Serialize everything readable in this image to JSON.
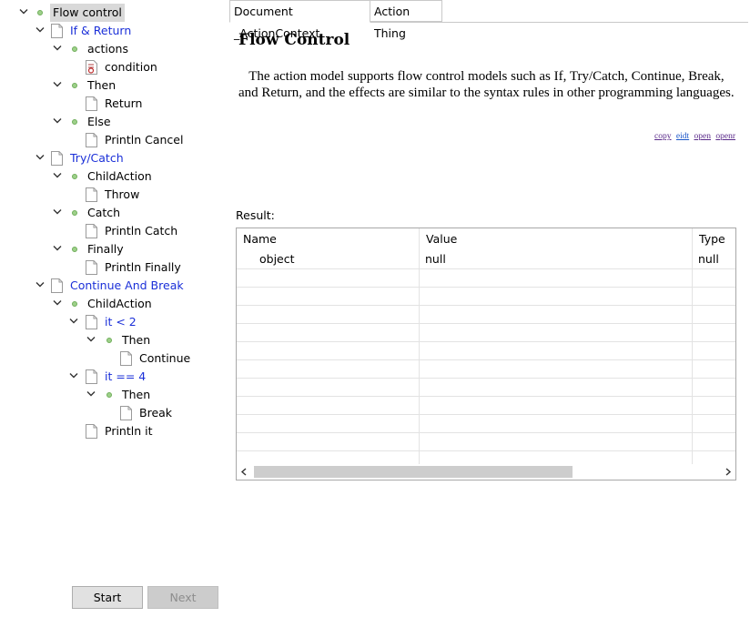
{
  "tree": {
    "nodes": [
      {
        "label": "Flow control",
        "kind": "dot",
        "expanded": true,
        "link": false,
        "selected": true
      },
      {
        "label": "If & Return",
        "kind": "doc",
        "expanded": true,
        "link": true
      },
      {
        "label": "actions",
        "kind": "dot",
        "expanded": true,
        "link": false
      },
      {
        "label": "condition",
        "kind": "doc-special",
        "expanded": null,
        "link": false
      },
      {
        "label": "Then",
        "kind": "dot",
        "expanded": true,
        "link": false
      },
      {
        "label": "Return",
        "kind": "doc",
        "expanded": null,
        "link": false
      },
      {
        "label": "Else",
        "kind": "dot",
        "expanded": true,
        "link": false
      },
      {
        "label": "Println Cancel",
        "kind": "doc",
        "expanded": null,
        "link": false
      },
      {
        "label": "Try/Catch",
        "kind": "doc",
        "expanded": true,
        "link": true
      },
      {
        "label": "ChildAction",
        "kind": "dot",
        "expanded": true,
        "link": false
      },
      {
        "label": "Throw",
        "kind": "doc",
        "expanded": null,
        "link": false
      },
      {
        "label": "Catch",
        "kind": "dot",
        "expanded": true,
        "link": false
      },
      {
        "label": "Println Catch",
        "kind": "doc",
        "expanded": null,
        "link": false
      },
      {
        "label": "Finally",
        "kind": "dot",
        "expanded": true,
        "link": false
      },
      {
        "label": "Println Finally",
        "kind": "doc",
        "expanded": null,
        "link": false
      },
      {
        "label": "Continue And Break",
        "kind": "doc",
        "expanded": true,
        "link": true
      },
      {
        "label": "ChildAction",
        "kind": "dot",
        "expanded": true,
        "link": false
      },
      {
        "label": "it < 2",
        "kind": "doc",
        "expanded": true,
        "link": true
      },
      {
        "label": "Then",
        "kind": "dot",
        "expanded": true,
        "link": false
      },
      {
        "label": "Continue",
        "kind": "doc",
        "expanded": null,
        "link": false
      },
      {
        "label": "it == 4",
        "kind": "doc",
        "expanded": true,
        "link": true
      },
      {
        "label": "Then",
        "kind": "dot",
        "expanded": true,
        "link": false
      },
      {
        "label": "Break",
        "kind": "doc",
        "expanded": null,
        "link": false
      },
      {
        "label": "Println it",
        "kind": "doc",
        "expanded": null,
        "link": false
      }
    ]
  },
  "buttons": {
    "start": "Start",
    "next": "Next"
  },
  "tabs": [
    {
      "label": "Document _ActionContext",
      "active": true
    },
    {
      "label": "Action Thing",
      "active": false
    }
  ],
  "document": {
    "title": "Flow Control",
    "body": "The action model supports flow control models such as If, Try/Catch, Continue, Break, and Return, and the effects are similar to the syntax rules in other programming languages.",
    "links": [
      "copy",
      "eidt",
      "open",
      "openr"
    ]
  },
  "result": {
    "label": "Result:",
    "columns": [
      "Name",
      "Value",
      "Type"
    ],
    "rows": [
      {
        "name": "object",
        "value": "null",
        "type": "null"
      }
    ]
  },
  "colors": {
    "link": "#1a2fd8",
    "dot": "#9ed08a",
    "selection": "#d9d9d9"
  }
}
